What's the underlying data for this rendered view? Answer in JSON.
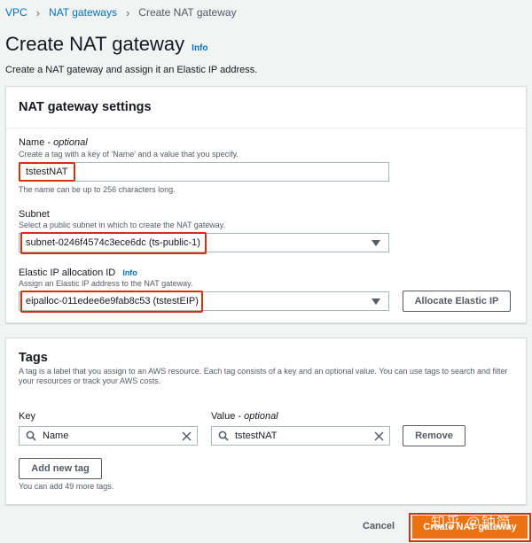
{
  "breadcrumb": {
    "items": [
      "VPC",
      "NAT gateways",
      "Create NAT gateway"
    ],
    "separator": ">"
  },
  "page": {
    "title": "Create NAT gateway",
    "info_label": "Info",
    "description": "Create a NAT gateway and assign it an Elastic IP address."
  },
  "settings": {
    "header": "NAT gateway settings",
    "name": {
      "label": "Name - ",
      "label_optional": "optional",
      "description": "Create a tag with a key of 'Name' and a value that you specify.",
      "value": "tstestNAT",
      "hint": "The name can be up to 256 characters long."
    },
    "subnet": {
      "label": "Subnet",
      "description": "Select a public subnet in which to create the NAT gateway.",
      "value": "subnet-0246f4574c3ece6dc (ts-public-1)"
    },
    "eip": {
      "label": "Elastic IP allocation ID",
      "info_label": "Info",
      "description": "Assign an Elastic IP address to the NAT gateway.",
      "value": "eipalloc-011edee6e9fab8c53 (tstestEIP)",
      "allocate_label": "Allocate Elastic IP"
    }
  },
  "tags": {
    "header": "Tags",
    "description": "A tag is a label that you assign to an AWS resource. Each tag consists of a key and an optional value. You can use tags to search and filter your resources or track your AWS costs.",
    "key_label": "Key",
    "value_label": "Value - ",
    "value_label_optional": "optional",
    "rows": [
      {
        "key": "Name",
        "value": "tstestNAT",
        "remove_label": "Remove"
      }
    ],
    "add_label": "Add new tag",
    "remaining_hint": "You can add 49 more tags."
  },
  "footer": {
    "cancel_label": "Cancel",
    "create_label": "Create NAT gateway"
  },
  "watermark": "知乎 @钟简",
  "colors": {
    "link": "#0073bb",
    "primary": "#ec7211",
    "highlight": "#d13212",
    "background": "#f2f3f3"
  },
  "icons": [
    "chevron-right-icon",
    "search-icon",
    "clear-icon",
    "caret-down-icon"
  ]
}
